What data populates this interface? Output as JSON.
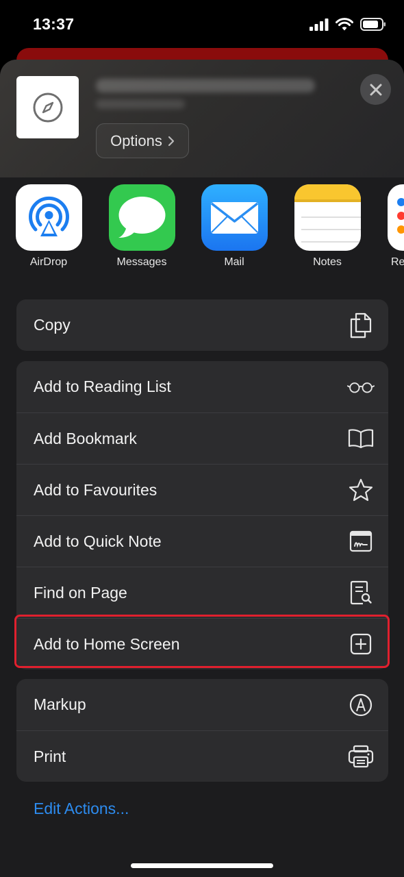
{
  "status_bar": {
    "time": "13:37"
  },
  "header": {
    "options_label": "Options"
  },
  "share_apps": [
    {
      "label": "AirDrop",
      "icon": "airdrop-icon"
    },
    {
      "label": "Messages",
      "icon": "messages-icon"
    },
    {
      "label": "Mail",
      "icon": "mail-icon"
    },
    {
      "label": "Notes",
      "icon": "notes-icon"
    },
    {
      "label": "Re",
      "icon": "reminders-icon"
    }
  ],
  "groups": [
    [
      {
        "label": "Copy",
        "icon": "copy-icon"
      }
    ],
    [
      {
        "label": "Add to Reading List",
        "icon": "glasses-icon"
      },
      {
        "label": "Add Bookmark",
        "icon": "book-icon"
      },
      {
        "label": "Add to Favourites",
        "icon": "star-icon"
      },
      {
        "label": "Add to Quick Note",
        "icon": "quick-note-icon"
      },
      {
        "label": "Find on Page",
        "icon": "find-page-icon"
      },
      {
        "label": "Add to Home Screen",
        "icon": "plus-square-icon",
        "highlighted": true
      }
    ],
    [
      {
        "label": "Markup",
        "icon": "markup-icon"
      },
      {
        "label": "Print",
        "icon": "printer-icon"
      }
    ]
  ],
  "edit_actions_label": "Edit Actions...",
  "colors": {
    "accent": "#2d8cf0",
    "highlight": "#e0202e",
    "sheet": "#1c1c1e",
    "row": "#2c2c2e"
  }
}
